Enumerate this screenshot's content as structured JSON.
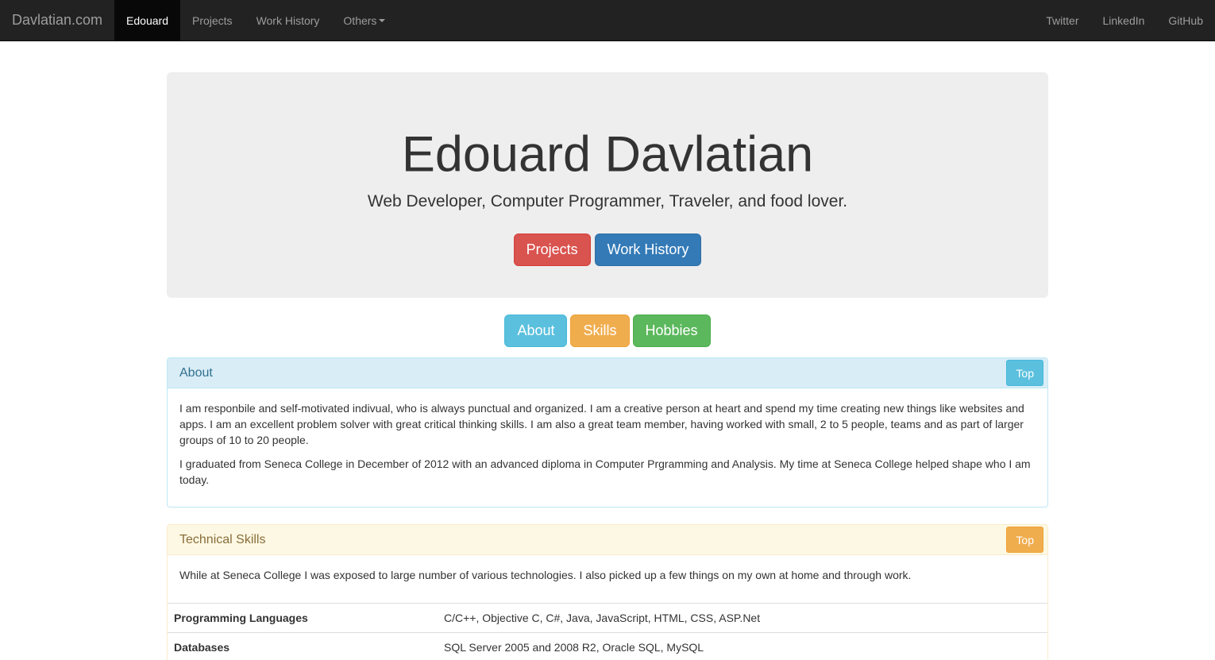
{
  "navbar": {
    "brand": "Davlatian.com",
    "items": [
      {
        "label": "Edouard"
      },
      {
        "label": "Projects"
      },
      {
        "label": "Work History"
      },
      {
        "label": "Others"
      }
    ],
    "right_items": [
      {
        "label": "Twitter"
      },
      {
        "label": "LinkedIn"
      },
      {
        "label": "GitHub"
      }
    ]
  },
  "hero": {
    "title": "Edouard Davlatian",
    "subtitle": "Web Developer, Computer Programmer, Traveler, and food lover.",
    "buttons": [
      {
        "label": "Projects"
      },
      {
        "label": "Work History"
      }
    ]
  },
  "section_nav": [
    {
      "label": "About"
    },
    {
      "label": "Skills"
    },
    {
      "label": "Hobbies"
    }
  ],
  "about_panel": {
    "title": "About",
    "top_label": "Top",
    "paragraphs": [
      "I am responbile and self-motivated indivual, who is always punctual and organized. I am a creative person at heart and spend my time creating new things like websites and apps. I am an excellent problem solver with great critical thinking skills. I am also a great team member, having worked with small, 2 to 5 people, teams and as part of larger groups of 10 to 20 people.",
      "I graduated from Seneca College in December of 2012 with an advanced diploma in Computer Prgramming and Analysis. My time at Seneca College helped shape who I am today."
    ]
  },
  "skills_panel": {
    "title": "Technical Skills",
    "top_label": "Top",
    "intro": "While at Seneca College I was exposed to large number of various technologies. I also picked up a few things on my own at home and through work.",
    "rows": [
      {
        "label": "Programming Languages",
        "value": "C/C++, Objective C, C#, Java, JavaScript, HTML, CSS, ASP.Net"
      },
      {
        "label": "Databases",
        "value": "SQL Server 2005 and 2008 R2, Oracle SQL, MySQL"
      }
    ]
  },
  "colors": {
    "navbar_bg": "#222222",
    "danger": "#d9534f",
    "primary": "#337ab7",
    "info": "#5bc0de",
    "warning": "#f0ad4e",
    "success": "#5cb85c"
  }
}
